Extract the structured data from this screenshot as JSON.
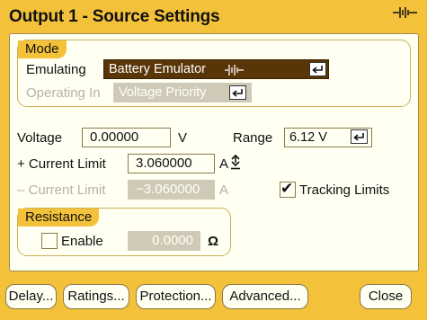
{
  "window": {
    "title": "Output 1 - Source Settings",
    "title_icon": "battery-symbol-icon"
  },
  "mode": {
    "group_label": "Mode",
    "emulating_label": "Emulating",
    "emulating_value": "Battery Emulator",
    "emulating_icon": "battery-symbol-icon",
    "operating_label": "Operating In",
    "operating_value": "Voltage Priority"
  },
  "voltage": {
    "label": "Voltage",
    "value": "0.00000",
    "unit": "V"
  },
  "range": {
    "label": "Range",
    "value": "6.12 V"
  },
  "current_limit_pos": {
    "label": "+ Current Limit",
    "value": "3.060000",
    "unit": "A"
  },
  "current_limit_neg": {
    "label": "– Current Limit",
    "value": "−3.060000",
    "unit": "A"
  },
  "tracking": {
    "label": "Tracking Limits",
    "checked": true,
    "mark": "✔"
  },
  "resistance": {
    "group_label": "Resistance",
    "enable_label": "Enable",
    "enabled": false,
    "value": "0.0000",
    "unit": "Ω"
  },
  "buttons": {
    "delay": "Delay...",
    "ratings": "Ratings...",
    "protection": "Protection...",
    "advanced": "Advanced...",
    "close": "Close"
  },
  "colors": {
    "frame": "#f4c23a",
    "panel": "#fffff2",
    "dropdown": "#5a3508",
    "disabled": "#cfcab7"
  }
}
